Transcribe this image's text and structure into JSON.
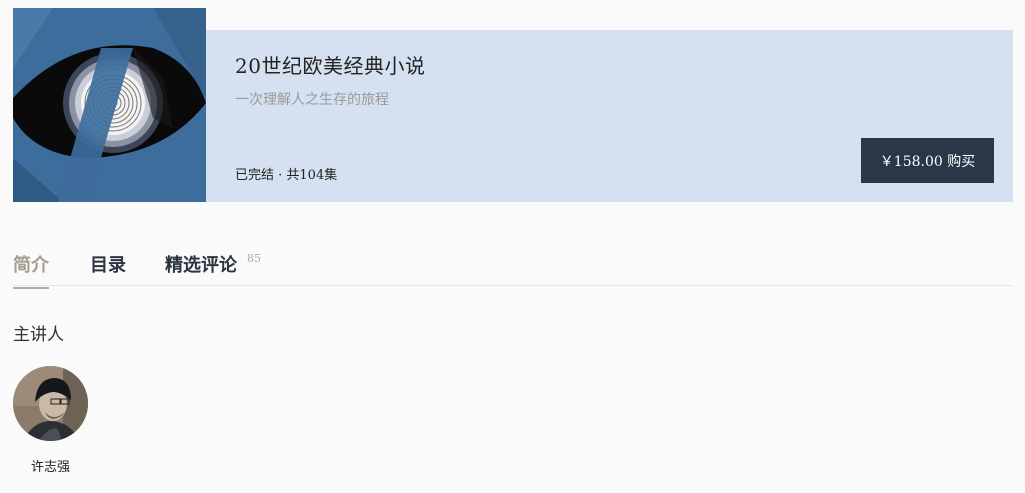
{
  "course": {
    "title": "20世纪欧美经典小说",
    "subtitle": "一次理解人之生存的旅程",
    "status": "已完结 · 共104集",
    "buy_label": "￥158.00 购买"
  },
  "tabs": [
    {
      "label": "简介",
      "active": true
    },
    {
      "label": "目录",
      "active": false
    },
    {
      "label": "精选评论",
      "active": false,
      "count": "85"
    }
  ],
  "lecturer": {
    "heading": "主讲人",
    "name": "许志强"
  },
  "colors": {
    "banner_bg": "#d5e1f0",
    "buy_button_bg": "#293746",
    "active_tab": "#a39c91",
    "tab_text": "#2c3440",
    "cover_blue": "#3d6d9c"
  }
}
